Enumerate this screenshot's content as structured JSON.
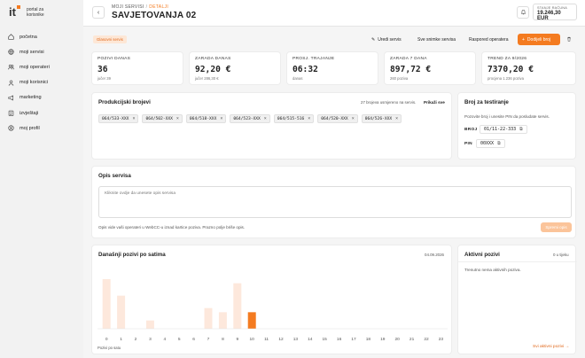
{
  "brand": {
    "logo": "it",
    "line1": "portal za",
    "line2": "korisnike"
  },
  "nav": [
    {
      "label": "početna",
      "icon": "home-icon"
    },
    {
      "label": "moji servisi",
      "icon": "globe-icon"
    },
    {
      "label": "moji operateri",
      "icon": "users-icon"
    },
    {
      "label": "moji korisnici",
      "icon": "user-icon"
    },
    {
      "label": "marketing",
      "icon": "megaphone-icon"
    },
    {
      "label": "izvještaji",
      "icon": "clipboard-icon"
    },
    {
      "label": "moj profil",
      "icon": "profile-icon"
    }
  ],
  "header": {
    "crumb_parent": "MOJI SERVISI",
    "crumb_sep": "/",
    "crumb_current": "DETALJI",
    "title": "SAVJETOVANJA 02",
    "balance_label": "STANJE RAČUNA",
    "balance_value": "19.246,30 EUR"
  },
  "actions": {
    "status": "Glasovni servis",
    "edit": "Uredi servis",
    "recordings": "Sve snimke servisa",
    "schedule": "Raspored operatera",
    "add_number": "Dodijeli broj"
  },
  "stats": [
    {
      "label": "POZIVI DANAS",
      "value": "36",
      "sub": "jučer 39"
    },
    {
      "label": "ZARADA DANAS",
      "value": "92,20 €",
      "sub": "jučer 286,30 €"
    },
    {
      "label": "PROSJ. TRAJANJE",
      "value": "06:32",
      "sub": "danas"
    },
    {
      "label": "ZARADA 7 DANA",
      "value": "897,72 €",
      "sub": "260 poziva"
    },
    {
      "label": "TREND ZA 9/2026",
      "value": "7370,20 €",
      "sub": "procjena 1.236 poziva"
    }
  ],
  "production": {
    "title": "Produkcijski brojevi",
    "info": "27 brojeva usmjereno na servis.",
    "show_all": "Prikaži sve",
    "numbers": [
      "064/533-XXX",
      "064/502-XXX",
      "064/518-XXX",
      "064/523-XXX",
      "064/515-516",
      "064/520-XXX",
      "064/526-XXX"
    ]
  },
  "test": {
    "title": "Broj za testiranje",
    "desc": "Pozovite broj i unesite PIN da posludate servis.",
    "number_label": "BROJ",
    "number_value": "01/11-22-333",
    "pin_label": "PIN",
    "pin_value": "00XXX"
  },
  "description": {
    "title": "Opis servisa",
    "placeholder": "Kliknite ovdje da unesete opis servisa",
    "note": "Opis vide vaši operateri u WebCC-u iznad kartice poziva. Prazno polje briše opis.",
    "save": "Spremi opis"
  },
  "calls_chart": {
    "date": "04.09.2026",
    "footer": "Pozivi po satu"
  },
  "chart_data": {
    "type": "bar",
    "title": "Današnji pozivi po satima",
    "xlabel": "Pozivi po satu",
    "categories": [
      "0",
      "1",
      "2",
      "3",
      "4",
      "5",
      "6",
      "7",
      "8",
      "9",
      "10",
      "11",
      "12",
      "13",
      "14",
      "15",
      "16",
      "17",
      "18",
      "19",
      "20",
      "21",
      "22",
      "23"
    ],
    "values": [
      12,
      8,
      0,
      2,
      0,
      0,
      0,
      5,
      4,
      11,
      4,
      0,
      0,
      0,
      0,
      0,
      0,
      0,
      0,
      0,
      0,
      0,
      0,
      0
    ],
    "highlight_index": 10,
    "colors": {
      "bar": "#fde8dc",
      "highlight": "#f47b20"
    }
  },
  "active": {
    "title": "Aktivni pozivi",
    "count": "0 u tijeku",
    "empty": "Trenutno nema aktivnih poziva.",
    "link": "Svi aktivni pozivi →"
  },
  "colors": {
    "accent": "#f47b20"
  }
}
